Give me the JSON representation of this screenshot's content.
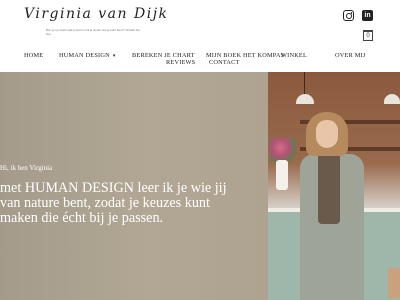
{
  "header": {
    "logo_name": "Virginia van Dijk",
    "logo_tagline": "Ben je op zoek naar jezelf en wil je weten wie je echt bent? Ontdek het hier.",
    "cart_count": "0",
    "social": {
      "instagram": "instagram-icon",
      "linkedin": "in"
    }
  },
  "nav": {
    "items": [
      {
        "label": "HOME"
      },
      {
        "label": "HUMAN DESIGN",
        "has_dropdown": true
      },
      {
        "label": "BEREKEN JE CHART"
      },
      {
        "label": "MIJN BOEK HET KOMPAS"
      },
      {
        "label": "WINKEL"
      },
      {
        "label": "OVER MIJ"
      },
      {
        "label": "REVIEWS"
      },
      {
        "label": "CONTACT"
      }
    ],
    "dropdown_caret": "▾"
  },
  "hero": {
    "subtitle": "Hi, ik ben Virginia",
    "title": "met HUMAN DESIGN leer ik je wie jij van nature bent, zodat je keuzes kunt maken die écht bij je passen."
  }
}
